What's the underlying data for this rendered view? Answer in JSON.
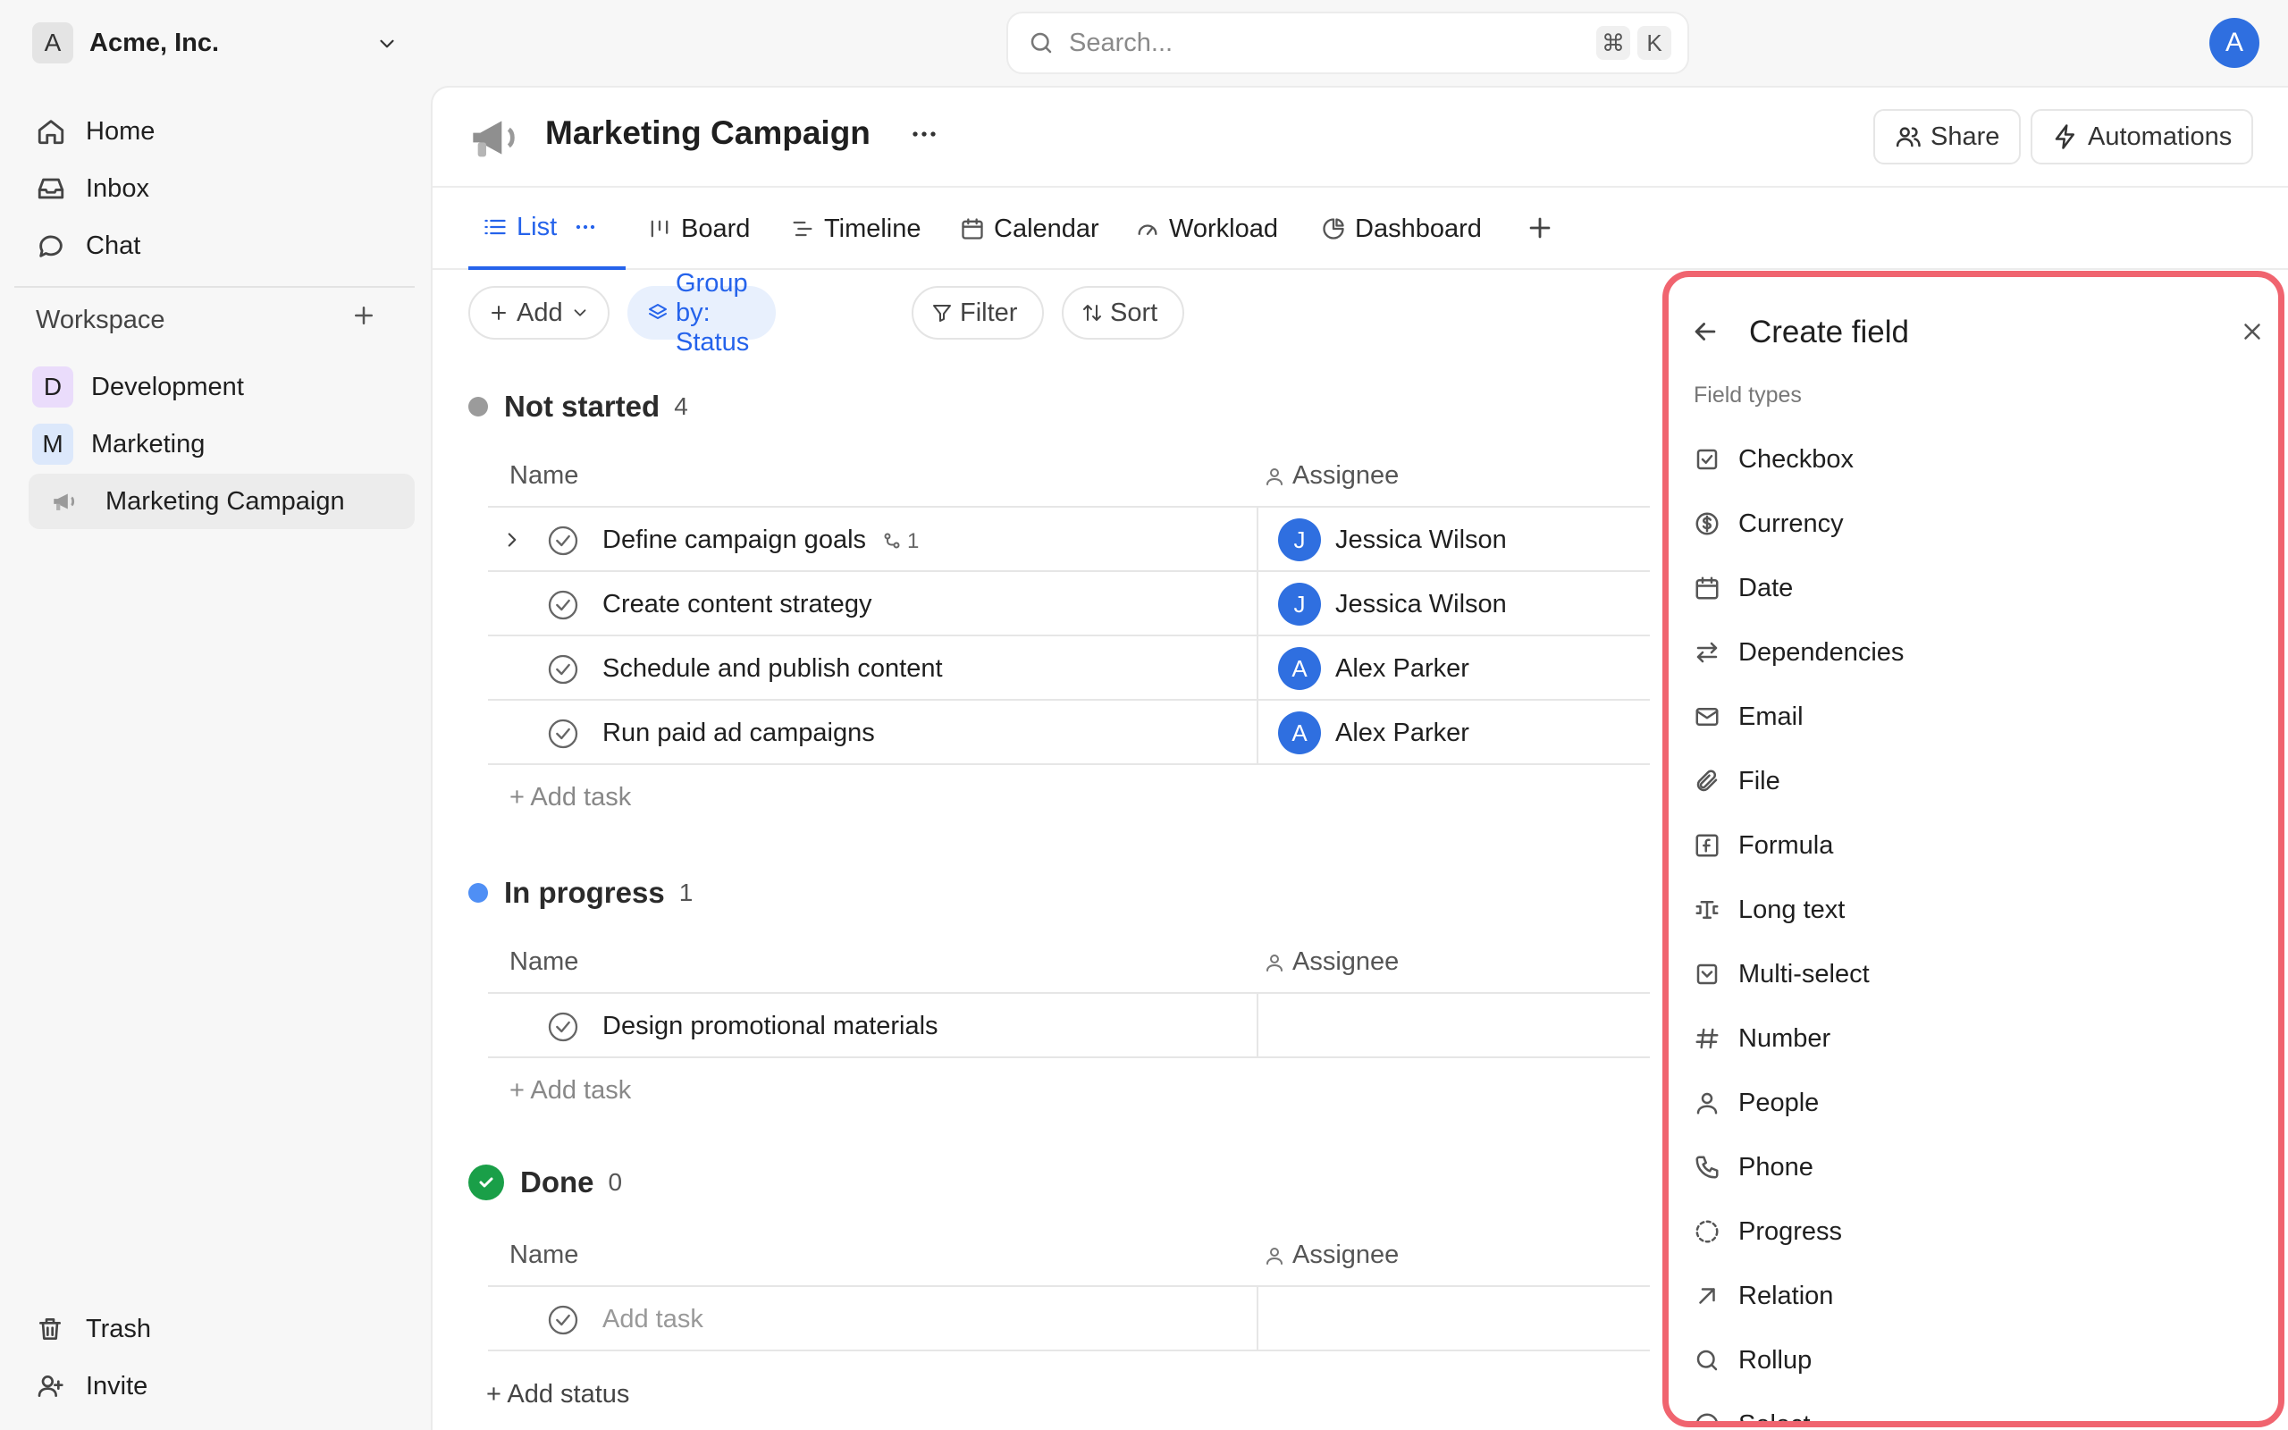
{
  "workspace_switcher": {
    "initial": "A",
    "name": "Acme, Inc."
  },
  "search": {
    "placeholder": "Search...",
    "shortcut_cmd": "⌘",
    "shortcut_key": "K"
  },
  "user": {
    "initial": "A"
  },
  "sidebar": {
    "nav": [
      {
        "label": "Home",
        "icon": "home-icon"
      },
      {
        "label": "Inbox",
        "icon": "inbox-icon"
      },
      {
        "label": "Chat",
        "icon": "chat-icon"
      }
    ],
    "workspace_title": "Workspace",
    "projects": [
      {
        "initial": "D",
        "label": "Development",
        "color": "#eadcfb"
      },
      {
        "initial": "M",
        "label": "Marketing",
        "color": "#dce8fb"
      },
      {
        "initial": "",
        "label": "Marketing Campaign",
        "icon": "megaphone-icon"
      }
    ],
    "footer": [
      {
        "label": "Trash",
        "icon": "trash-icon"
      },
      {
        "label": "Invite",
        "icon": "invite-icon"
      }
    ]
  },
  "page": {
    "title": "Marketing Campaign",
    "share_label": "Share",
    "automations_label": "Automations"
  },
  "tabs": [
    {
      "label": "List",
      "icon": "list-icon",
      "active": true
    },
    {
      "label": "Board",
      "icon": "board-icon"
    },
    {
      "label": "Timeline",
      "icon": "timeline-icon"
    },
    {
      "label": "Calendar",
      "icon": "calendar-icon"
    },
    {
      "label": "Workload",
      "icon": "gauge-icon"
    },
    {
      "label": "Dashboard",
      "icon": "pie-icon"
    }
  ],
  "toolbar": {
    "add_label": "Add",
    "group_label": "Group by: Status",
    "filter_label": "Filter",
    "sort_label": "Sort"
  },
  "columns": {
    "name": "Name",
    "assignee": "Assignee"
  },
  "groups": [
    {
      "title": "Not started",
      "count": "4",
      "color": "#9b9b9b",
      "tasks": [
        {
          "name": "Define campaign goals",
          "subtasks": "1",
          "assignee": "Jessica Wilson",
          "initial": "J"
        },
        {
          "name": "Create content strategy",
          "assignee": "Jessica Wilson",
          "initial": "J"
        },
        {
          "name": "Schedule and publish content",
          "assignee": "Alex Parker",
          "initial": "A"
        },
        {
          "name": "Run paid ad campaigns",
          "assignee": "Alex Parker",
          "initial": "A"
        }
      ]
    },
    {
      "title": "In progress",
      "count": "1",
      "color": "#4f8ff5",
      "tasks": [
        {
          "name": "Design promotional materials",
          "assignee": "",
          "initial": ""
        }
      ]
    },
    {
      "title": "Done",
      "count": "0",
      "color": "#1a9f48",
      "tasks": [
        {
          "name": "Add task",
          "assignee": "",
          "initial": ""
        }
      ]
    }
  ],
  "add_task_label": "+ Add task",
  "add_status_label": "+ Add status",
  "panel": {
    "title": "Create field",
    "section": "Field types",
    "items": [
      {
        "label": "Checkbox",
        "icon": "checkbox-icon"
      },
      {
        "label": "Currency",
        "icon": "currency-icon"
      },
      {
        "label": "Date",
        "icon": "calendar-icon"
      },
      {
        "label": "Dependencies",
        "icon": "arrows-icon"
      },
      {
        "label": "Email",
        "icon": "mail-icon"
      },
      {
        "label": "File",
        "icon": "paperclip-icon"
      },
      {
        "label": "Formula",
        "icon": "formula-icon"
      },
      {
        "label": "Long text",
        "icon": "long-text-icon"
      },
      {
        "label": "Multi-select",
        "icon": "multi-select-icon"
      },
      {
        "label": "Number",
        "icon": "hash-icon"
      },
      {
        "label": "People",
        "icon": "person-icon"
      },
      {
        "label": "Phone",
        "icon": "phone-icon"
      },
      {
        "label": "Progress",
        "icon": "progress-icon"
      },
      {
        "label": "Relation",
        "icon": "arrow-up-right-icon"
      },
      {
        "label": "Rollup",
        "icon": "search-icon"
      },
      {
        "label": "Select",
        "icon": "select-icon"
      }
    ]
  }
}
